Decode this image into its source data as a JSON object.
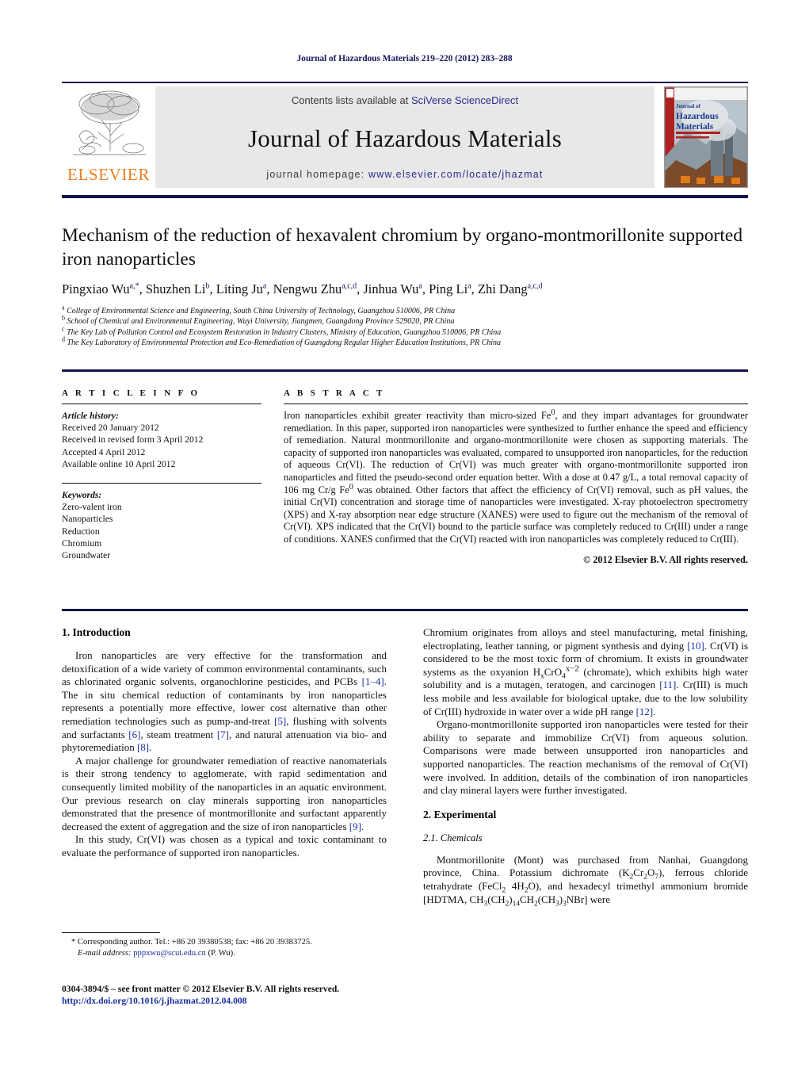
{
  "running_head": "Journal of Hazardous Materials 219–220 (2012) 283–288",
  "masthead": {
    "contents_prefix": "Contents lists available at ",
    "contents_link": "SciVerse ScienceDirect",
    "journal_title": "Journal of Hazardous Materials",
    "homepage_prefix": "journal homepage: ",
    "homepage_url": "www.elsevier.com/locate/jhazmat",
    "publisher": "ELSEVIER",
    "cover_title_line1": "Journal of",
    "cover_title_line2": "Hazardous",
    "cover_title_line3": "Materials"
  },
  "article": {
    "title": "Mechanism of the reduction of hexavalent chromium by organo-montmorillonite supported iron nanoparticles",
    "authors_html": "Pingxiao Wu<sup>a,*</sup>, Shuzhen Li<sup>b</sup>, Liting Ju<sup>a</sup>, Nengwu Zhu<sup>a,c,d</sup>, Jinhua Wu<sup>a</sup>, Ping Li<sup>a</sup>, Zhi Dang<sup>a,c,d</sup>",
    "affiliations": [
      {
        "marker": "a",
        "text": "College of Environmental Science and Engineering, South China University of Technology, Guangzhou 510006, PR China"
      },
      {
        "marker": "b",
        "text": "School of Chemical and Environmental Engineering, Wuyi University, Jiangmen, Guangdong Province 529020, PR China"
      },
      {
        "marker": "c",
        "text": "The Key Lab of Pollution Control and Ecosystem Restoration in Industry Clusters, Ministry of Education, Guangzhou 510006, PR China"
      },
      {
        "marker": "d",
        "text": "The Key Laboratory of Environmental Protection and Eco-Remediation of Guangdong Regular Higher Education Institutions, PR China"
      }
    ]
  },
  "article_info": {
    "heading": "A R T I C L E    I N F O",
    "history_label": "Article history:",
    "history": [
      "Received 20 January 2012",
      "Received in revised form 3 April 2012",
      "Accepted 4 April 2012",
      "Available online 10 April 2012"
    ],
    "keywords_label": "Keywords:",
    "keywords": [
      "Zero-valent iron",
      "Nanoparticles",
      "Reduction",
      "Chromium",
      "Groundwater"
    ]
  },
  "abstract": {
    "heading": "A B S T R A C T",
    "body_html": "Iron nanoparticles exhibit greater reactivity than micro-sized Fe<sup>0</sup>, and they impart advantages for groundwater remediation. In this paper, supported iron nanoparticles were synthesized to further enhance the speed and efficiency of remediation. Natural montmorillonite and organo-montmorillonite were chosen as supporting materials. The capacity of supported iron nanoparticles was evaluated, compared to unsupported iron nanoparticles, for the reduction of aqueous Cr(VI). The reduction of Cr(VI) was much greater with organo-montmorillonite supported iron nanoparticles and fitted the pseudo-second order equation better. With a dose at 0.47 g/L, a total removal capacity of 106 mg Cr/g Fe<sup>0</sup> was obtained. Other factors that affect the efficiency of Cr(VI) removal, such as pH values, the initial Cr(VI) concentration and storage time of nanoparticles were investigated. X-ray photoelectron spectrometry (XPS) and X-ray absorption near edge structure (XANES) were used to figure out the mechanism of the removal of Cr(VI). XPS indicated that the Cr(VI) bound to the particle surface was completely reduced to Cr(III) under a range of conditions. XANES confirmed that the Cr(VI) reacted with iron nanoparticles was completely reduced to Cr(III).",
    "copyright": "© 2012 Elsevier B.V. All rights reserved."
  },
  "sections": {
    "intro_heading": "1.  Introduction",
    "intro_p1_html": "Iron nanoparticles are very effective for the transformation and detoxification of a wide variety of common environmental contaminants, such as chlorinated organic solvents, organochlorine pesticides, and PCBs <span class=\"ref\">[1–4]</span>. The in situ chemical reduction of contaminants by iron nanoparticles represents a potentially more effective, lower cost alternative than other remediation technologies such as pump-and-treat <span class=\"ref\">[5]</span>, flushing with solvents and surfactants <span class=\"ref\">[6]</span>, steam treatment <span class=\"ref\">[7]</span>, and natural attenuation via bio- and phytoremediation <span class=\"ref\">[8]</span>.",
    "intro_p2_html": "A major challenge for groundwater remediation of reactive nanomaterials is their strong tendency to agglomerate, with rapid sedimentation and consequently limited mobility of the nanoparticles in an aquatic environment. Our previous research on clay minerals supporting iron nanoparticles demonstrated that the presence of montmorillonite and surfactant apparently decreased the extent of aggregation and the size of iron nanoparticles <span class=\"ref\">[9]</span>.",
    "intro_p3_html": "In this study, Cr(VI) was chosen as a typical and toxic contaminant to evaluate the performance of supported iron nanoparticles.",
    "intro_p4_html": "Chromium originates from alloys and steel manufacturing, metal finishing, electroplating, leather tanning, or pigment synthesis and dying <span class=\"ref\">[10]</span>. Cr(VI) is considered to be the most toxic form of chromium. It exists in groundwater systems as the oxyanion H<sub>x</sub>CrO<sub>4</sub><sup>x−2</sup> (chromate), which exhibits high water solubility and is a mutagen, teratogen, and carcinogen <span class=\"ref\">[11]</span>. Cr(III) is much less mobile and less available for biological uptake, due to the low solubility of Cr(III) hydroxide in water over a wide pH range <span class=\"ref\">[12]</span>.",
    "intro_p5_html": "Organo-montmorillonite supported iron nanoparticles were tested for their ability to separate and immobilize Cr(VI) from aqueous solution. Comparisons were made between unsupported iron nanoparticles and supported nanoparticles. The reaction mechanisms of the removal of Cr(VI) were involved. In addition, details of the combination of iron nanoparticles and clay mineral layers were further investigated.",
    "experimental_heading": "2.  Experimental",
    "chemicals_heading": "2.1.  Chemicals",
    "chemicals_p1_html": "Montmorillonite (Mont) was purchased from Nanhai, Guangdong province, China. Potassium dichromate (K<sub>2</sub>Cr<sub>2</sub>O<sub>7</sub>), ferrous chloride tetrahydrate (FeCl<sub>2</sub> 4H<sub>2</sub>O), and hexadecyl trimethyl ammonium bromide [HDTMA, CH<sub>3</sub>(CH<sub>2</sub>)<sub>14</sub>CH<sub>2</sub>(CH<sub>3</sub>)<sub>3</sub>NBr] were"
  },
  "footnotes": {
    "corresponding_html": "* Corresponding author. Tel.: +86 20 39380538; fax: +86 20 39383725.",
    "email_html": "<span class=\"ital\">E-mail address:</span> <span class=\"mail\">pppxwu@scut.edu.cn</span> (P. Wu).",
    "issn_line": "0304-3894/$ – see front matter © 2012 Elsevier B.V. All rights reserved.",
    "doi_line": "http://dx.doi.org/10.1016/j.jhazmat.2012.04.008"
  },
  "colors": {
    "heading_navy": "#13134a",
    "link_blue": "#2b2b8f",
    "elsevier_orange": "#ed7d20",
    "masthead_grey": "#e8e8e8"
  }
}
